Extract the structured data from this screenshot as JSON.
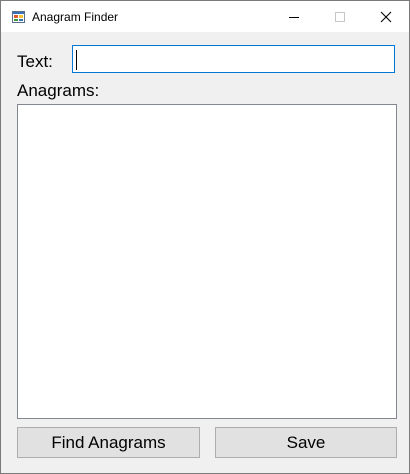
{
  "window": {
    "title": "Anagram Finder",
    "app_icon": "windows-form-icon",
    "controls": {
      "minimize_icon": "minimize-icon",
      "maximize_icon": "maximize-icon",
      "close_icon": "close-icon"
    }
  },
  "form": {
    "text_label": "Text:",
    "text_value": "",
    "anagrams_label": "Anagrams:",
    "anagram_items": []
  },
  "buttons": {
    "find_label": "Find Anagrams",
    "save_label": "Save"
  },
  "colors": {
    "titlebar": "#ffffff",
    "window_background": "#f0f0f0",
    "input_focus_border": "#0078d7",
    "button_face": "#e1e1e1",
    "button_border": "#adadad"
  }
}
